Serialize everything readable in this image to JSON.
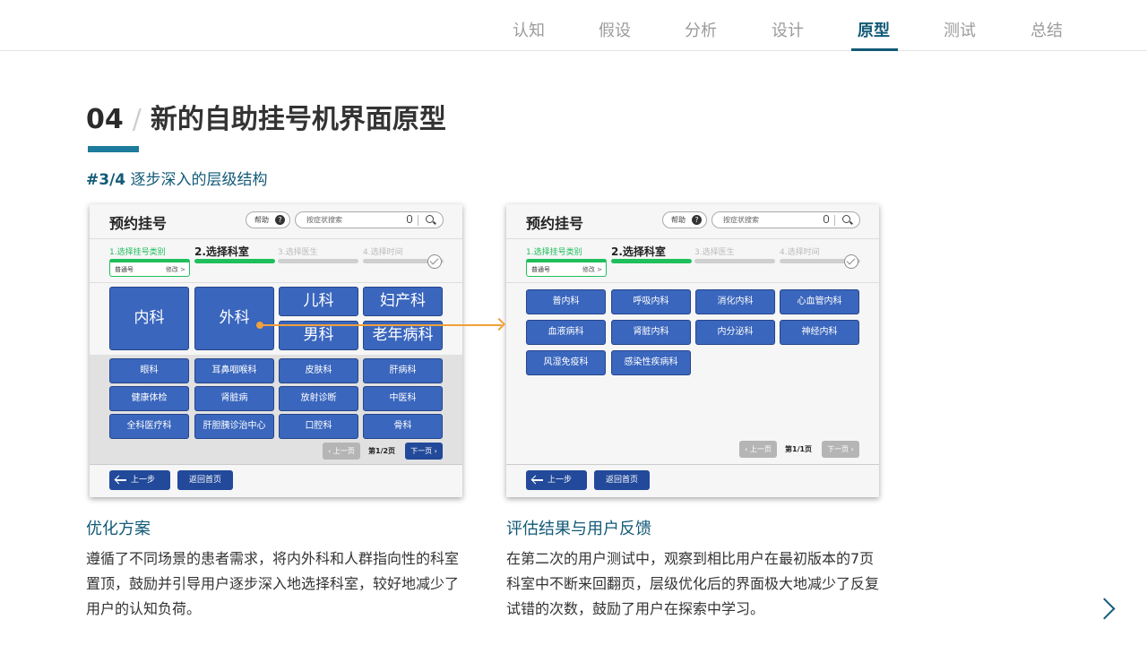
{
  "nav": {
    "items": [
      "认知",
      "假设",
      "分析",
      "设计",
      "原型",
      "测试",
      "总结"
    ],
    "active": "原型"
  },
  "header": {
    "number": "04",
    "slash": "/",
    "title": "新的自助挂号机界面原型",
    "subtitle_hash": "#3/4",
    "subtitle": "逐步深入的层级结构"
  },
  "kiosk": {
    "app_title": "预约挂号",
    "help_label": "帮助",
    "search_placeholder": "按症状搜索",
    "steps": [
      "1.选择挂号类别",
      "2.选择科室",
      "3.选择医生",
      "4.选择时间"
    ],
    "selected_type": "普通号",
    "modify_label": "修改 >",
    "back_label": "上一步",
    "home_label": "返回首页",
    "prev_label": "上一页",
    "next_label": "下一页"
  },
  "left_panel": {
    "top_depts": [
      "内科",
      "外科",
      "儿科",
      "妇产科",
      "男科",
      "老年病科"
    ],
    "other_depts": [
      "眼科",
      "耳鼻咽喉科",
      "皮肤科",
      "肝病科",
      "健康体检",
      "肾脏病",
      "放射诊断",
      "中医科",
      "全科医疗科",
      "肝胆胰诊治中心",
      "口腔科",
      "骨科"
    ],
    "page": "第1/2页"
  },
  "right_panel": {
    "depts": [
      "普内科",
      "呼吸内科",
      "消化内科",
      "心血管内科",
      "血液病科",
      "肾脏内科",
      "内分泌科",
      "神经内科",
      "风湿免疫科",
      "感染性疾病科"
    ],
    "page": "第1/1页"
  },
  "sections": {
    "left_heading": "优化方案",
    "left_text": "遵循了不同场景的患者需求，将内外科和人群指向性的科室置顶，鼓励并引导用户逐步深入地选择科室，较好地减少了用户的认知负荷。",
    "right_heading": "评估结果与用户反馈",
    "right_text": "在第二次的用户测试中，观察到相比用户在最初版本的7页科室中不断来回翻页，层级优化后的界面极大地减少了反复试错的次数，鼓励了用户在探索中学习。"
  },
  "colors": {
    "accent": "#125a77",
    "button_blue": "#3a66bd",
    "step_green": "#1fbf5c",
    "arrow_orange": "#f0a03c"
  }
}
